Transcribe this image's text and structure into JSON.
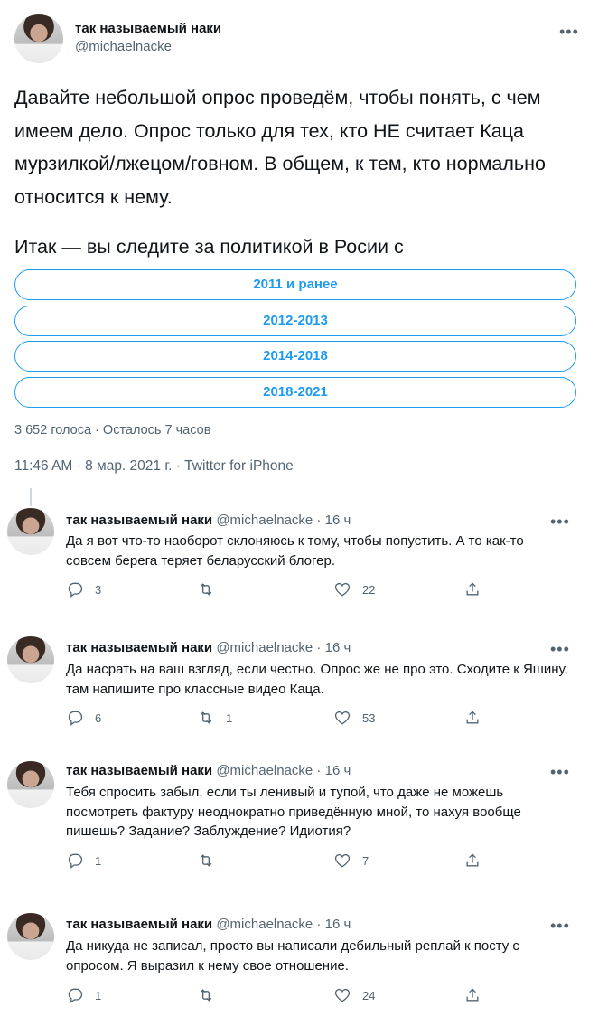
{
  "tweet": {
    "author_name": "так называемый наки",
    "author_handle": "@michaelnacke",
    "more_label": "•••",
    "text_1": "Давайте небольшой опрос проведём, чтобы понять, с чем имеем дело. Опрос только для тех, кто НЕ считает Каца мурзилкой/лжецом/говном. В общем, к тем, кто нормально относится к нему.",
    "text_2": "Итак — вы следите за политикой в Росии с",
    "poll": {
      "options": [
        "2011 и ранее",
        "2012-2013",
        "2014-2018",
        "2018-2021"
      ],
      "meta": "3 652 голоса · Осталось 7 часов"
    },
    "timestamp": "11:46 AM · 8 мар. 2021 г. · Twitter for iPhone",
    "accent_color": "#1d9bf0"
  },
  "replies": [
    {
      "name": "так называемый наки",
      "meta": "@michaelnacke · 16 ч",
      "text": "Да я вот что-то наоборот склоняюсь к тому, чтобы попустить. А то как-то совсем берега теряет беларусский блогер.",
      "reply_count": "3",
      "retweet_count": "",
      "like_count": "22"
    },
    {
      "name": "так называемый наки",
      "meta": "@michaelnacke · 16 ч",
      "text": "Да насрать на ваш взгляд, если честно. Опрос же не про это. Сходите к Яшину, там напишите про классные видео Каца.",
      "reply_count": "6",
      "retweet_count": "1",
      "like_count": "53"
    },
    {
      "name": "так называемый наки",
      "meta": "@michaelnacke · 16 ч",
      "text": "Тебя спросить забыл, если ты ленивый и тупой, что даже не можешь посмотреть фактуру неоднократно приведённую мной, то нахуя вообще пишешь? Задание? Заблуждение? Идиотия?",
      "reply_count": "1",
      "retweet_count": "",
      "like_count": "7"
    },
    {
      "name": "так называемый наки",
      "meta": "@michaelnacke · 16 ч",
      "text": "Да никуда не записал, просто вы написали дебильный реплай к посту с опросом. Я выразил к нему свое отношение.",
      "reply_count": "1",
      "retweet_count": "",
      "like_count": "24"
    }
  ],
  "icons": {
    "reply": "reply-icon",
    "retweet": "retweet-icon",
    "like": "heart-icon",
    "share": "share-icon",
    "more": "more-icon"
  }
}
